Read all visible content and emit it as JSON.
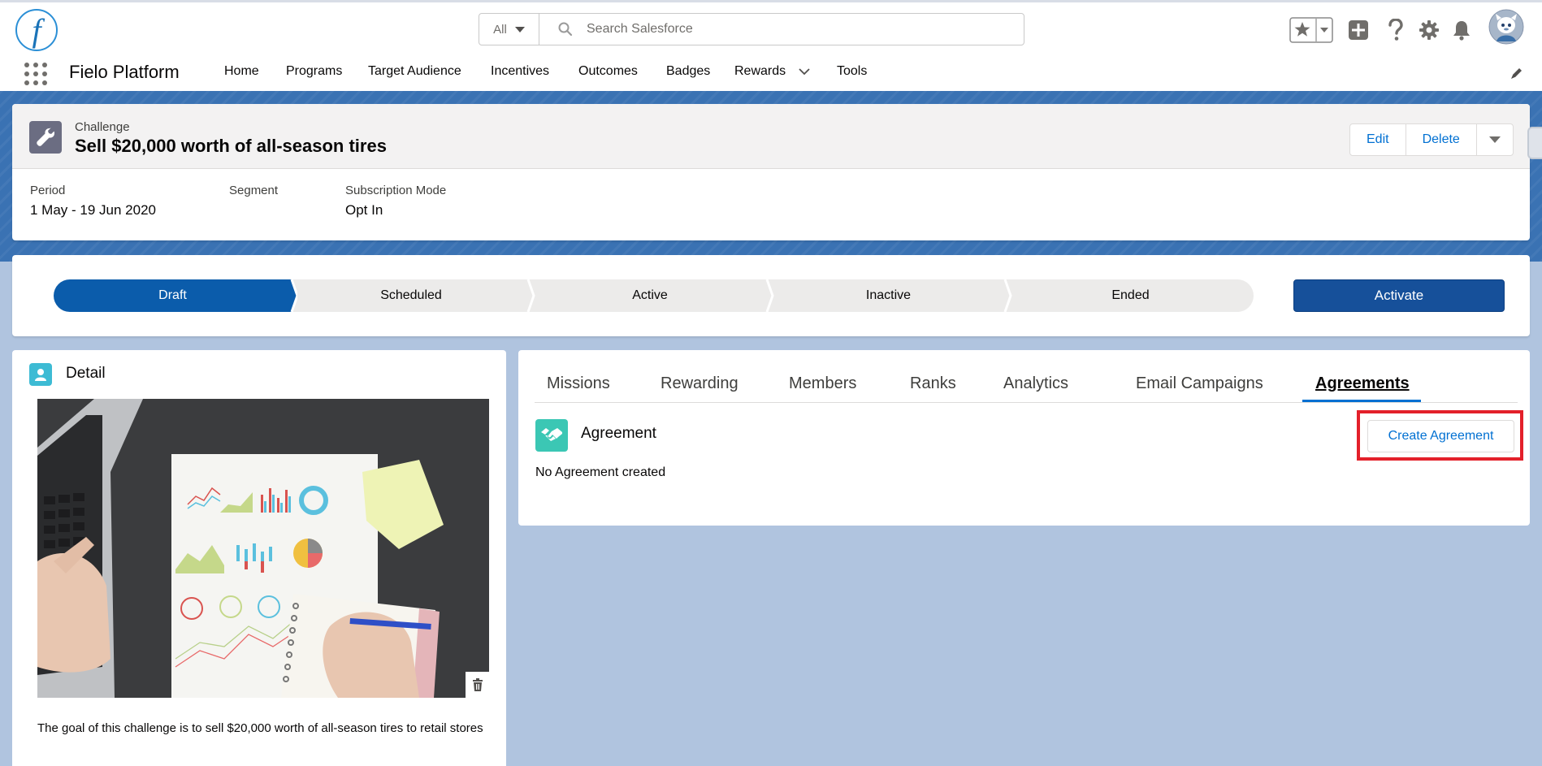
{
  "header": {
    "search": {
      "scope": "All",
      "placeholder": "Search Salesforce"
    },
    "icons": [
      "favorites-star-icon",
      "add-icon",
      "help-icon",
      "setup-gear-icon",
      "notifications-bell-icon",
      "user-avatar"
    ]
  },
  "nav": {
    "app_name": "Fielo Platform",
    "items": [
      "Home",
      "Programs",
      "Target Audience",
      "Incentives",
      "Outcomes",
      "Badges",
      "Rewards",
      "Tools"
    ]
  },
  "record": {
    "type": "Challenge",
    "title": "Sell $20,000 worth of all-season tires",
    "actions": {
      "edit": "Edit",
      "delete": "Delete"
    },
    "fields": [
      {
        "label": "Period",
        "value": "1 May - 19 Jun 2020"
      },
      {
        "label": "Segment",
        "value": ""
      },
      {
        "label": "Subscription Mode",
        "value": "Opt In"
      }
    ]
  },
  "path": {
    "stages": [
      "Draft",
      "Scheduled",
      "Active",
      "Inactive",
      "Ended"
    ],
    "current": "Draft",
    "action": "Activate"
  },
  "detail": {
    "title": "Detail",
    "description": "The goal of this challenge is to sell $20,000 worth of all-season tires to retail stores"
  },
  "tabs": {
    "items": [
      "Missions",
      "Rewarding",
      "Members",
      "Ranks",
      "Analytics",
      "Email Campaigns",
      "Agreements"
    ],
    "active": "Agreements"
  },
  "agreements": {
    "title": "Agreement",
    "empty_text": "No Agreement created",
    "create_label": "Create Agreement"
  },
  "colors": {
    "brand_blue": "#0070d2",
    "path_current": "#0b5cab",
    "activate": "#16509a",
    "highlight": "#e3202a",
    "page_bg": "#b0c4df"
  }
}
